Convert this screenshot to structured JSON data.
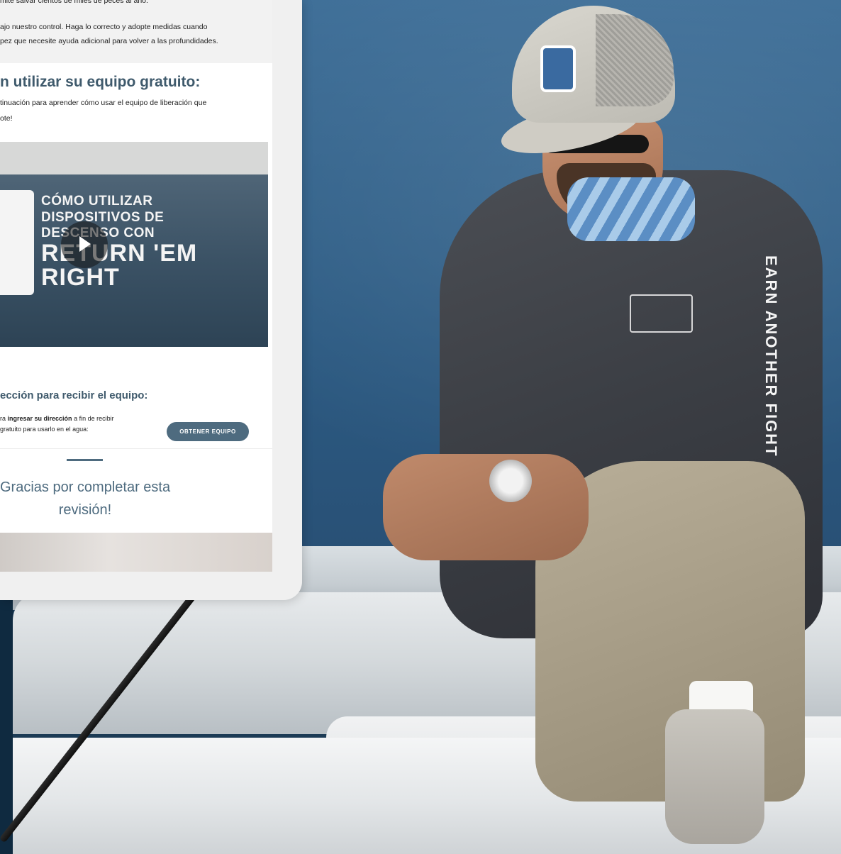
{
  "intro": {
    "line1": "mite salvar cientos de miles de peces al año.",
    "line2": "ajo nuestro control. Haga lo correcto y adopte medidas cuando",
    "line3": "pez que necesite ayuda adicional para volver a las profundidades."
  },
  "equipment": {
    "title": "n utilizar su equipo gratuito:",
    "text1": "tinuación para aprender cómo usar el equipo de liberación que",
    "text2": "ote!"
  },
  "video": {
    "line1": "CÓMO UTILIZAR",
    "line2": "DISPOSITIVOS DE",
    "line3": "DESCENSO CON",
    "line4": "RETURN 'EM",
    "line5": "RIGHT"
  },
  "address": {
    "title": "ección para recibir el equipo:",
    "text1_prefix": "ra ",
    "text1_bold": "ingresar su dirección",
    "text1_suffix": " a fin de recibir",
    "text2": "gratuito para usarlo en el agua:",
    "cta_label": "OBTENER EQUIPO"
  },
  "thanks": {
    "line1": "Gracias por completar esta",
    "line2": "revisión!"
  },
  "apparel": {
    "sleeve_text": "EARN ANOTHER FIGHT",
    "chest_logo": "RETURN'EM RIGHT"
  },
  "colors": {
    "brand": "#4e6b7f",
    "heading": "#3f5a6c",
    "sea": "#33638c"
  }
}
